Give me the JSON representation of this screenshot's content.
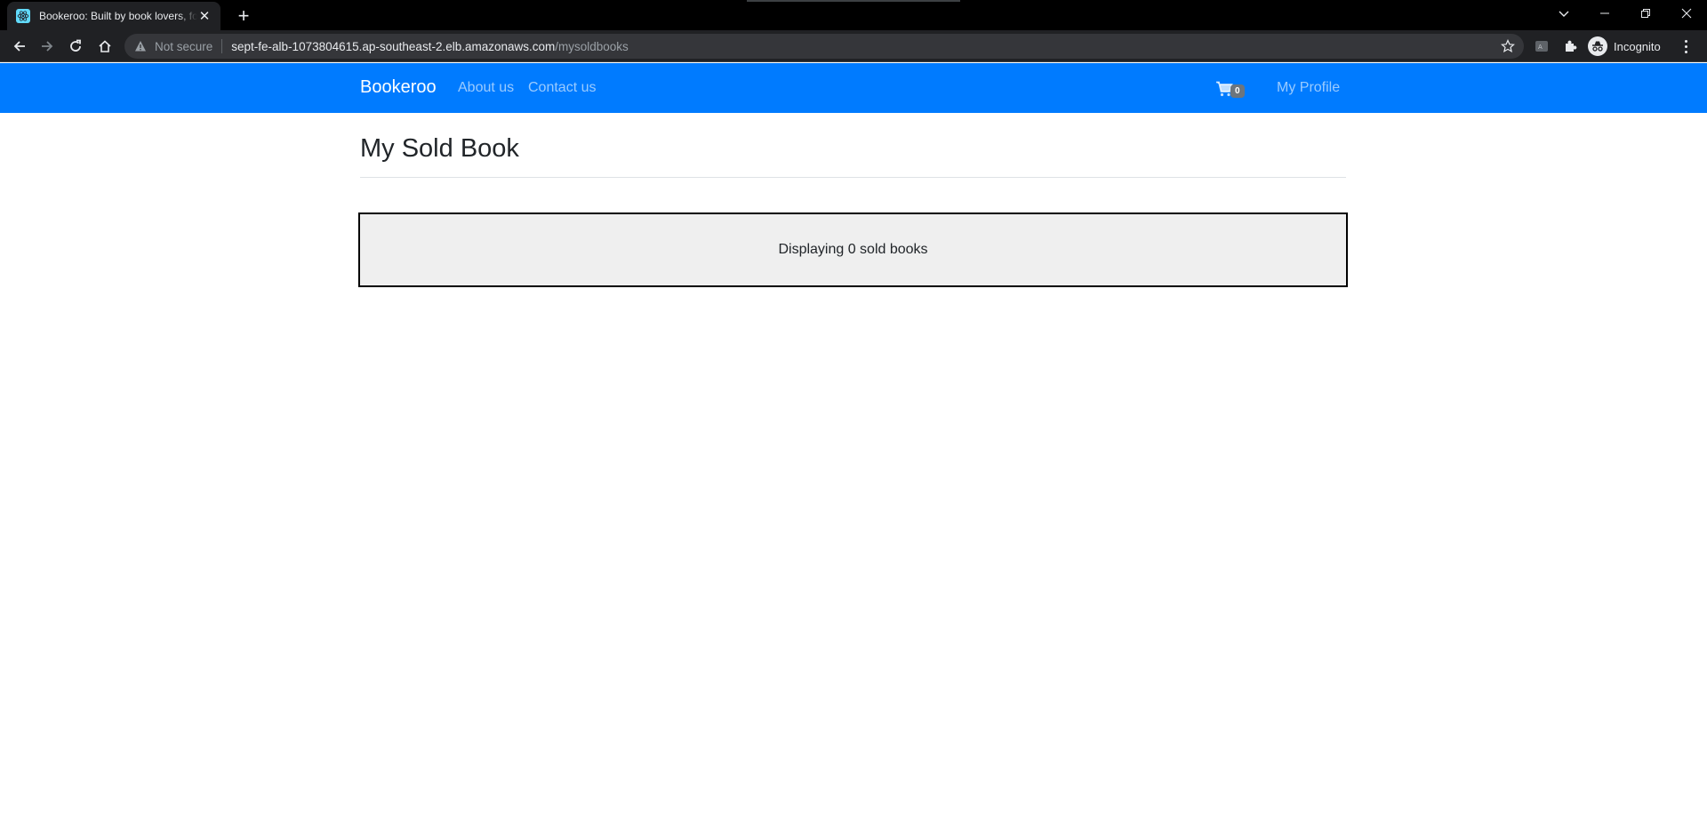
{
  "browser": {
    "tab_title": "Bookeroo: Built by book lovers, for book lovers",
    "url_security": "Not secure",
    "url_host": "sept-fe-alb-1073804615.ap-southeast-2.elb.amazonaws.com",
    "url_path": "/mysoldbooks",
    "profile_label": "Incognito"
  },
  "navbar": {
    "brand": "Bookeroo",
    "links": [
      {
        "label": "About us"
      },
      {
        "label": "Contact us"
      }
    ],
    "cart_count": "0",
    "profile_link": "My Profile"
  },
  "main": {
    "title": "My Sold Book",
    "sold_summary": "Displaying 0 sold books"
  },
  "colors": {
    "navbar_bg": "#007bff",
    "box_bg": "#efefef"
  }
}
